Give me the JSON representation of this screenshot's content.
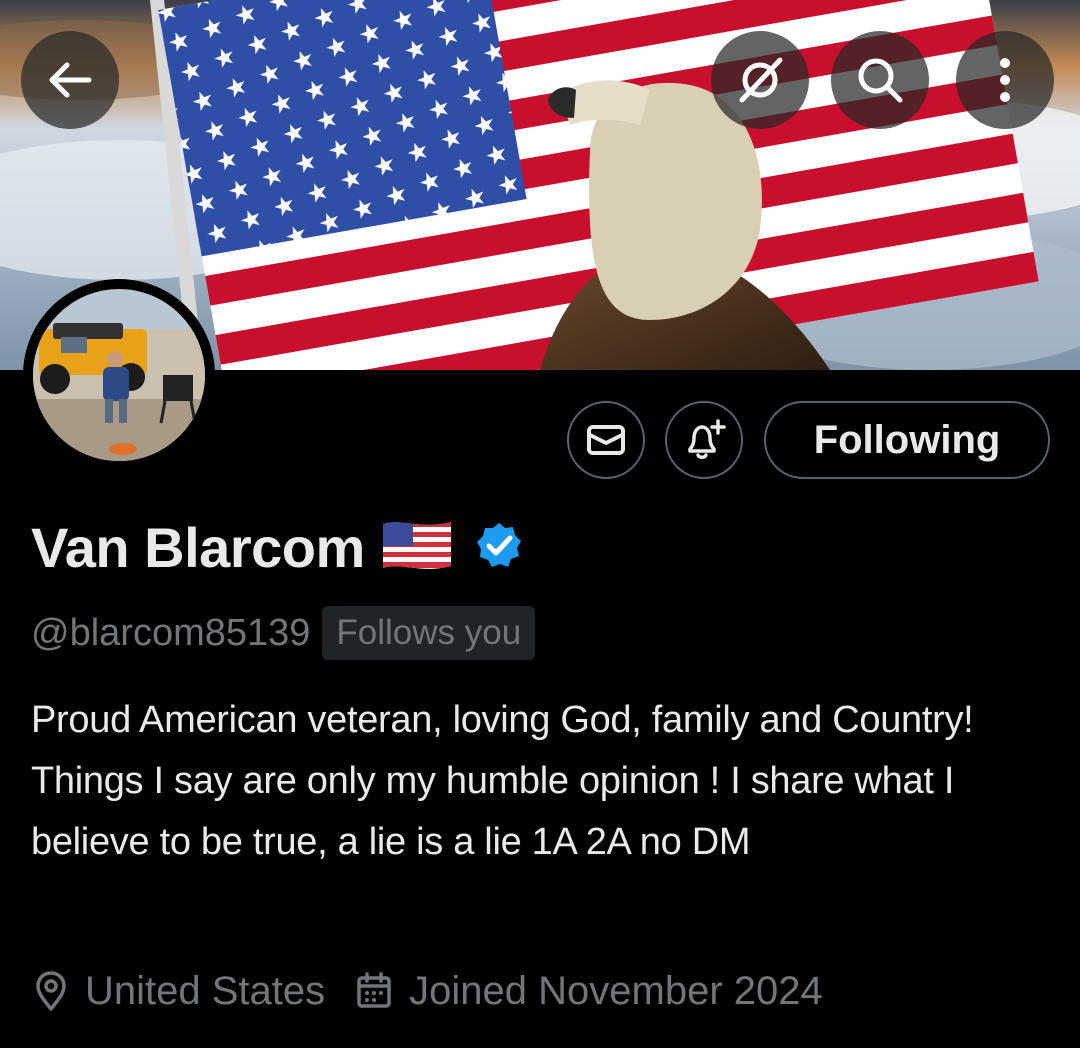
{
  "header": {
    "back_icon": "arrow-left-icon",
    "grok_icon": "grok-icon",
    "search_icon": "search-icon",
    "more_icon": "more-vertical-icon"
  },
  "actions": {
    "message_icon": "mail-icon",
    "notify_icon": "bell-plus-icon",
    "follow_label": "Following"
  },
  "profile": {
    "display_name": "Van Blarcom",
    "name_emoji": "us-flag",
    "verified": true,
    "handle": "@blarcom85139",
    "follows_you": "Follows you",
    "bio": "Proud American veteran, loving God, family and Country! Things I say are only my humble opinion ! I share what I believe to be true, a lie is a lie 1A 2A no DM",
    "location": "United States",
    "joined": "Joined November 2024"
  },
  "colors": {
    "background": "#000000",
    "text_primary": "#e7e9ea",
    "text_secondary": "#71767b",
    "border": "#536471",
    "verified_blue": "#1d9bf0",
    "badge_bg": "#202327"
  }
}
